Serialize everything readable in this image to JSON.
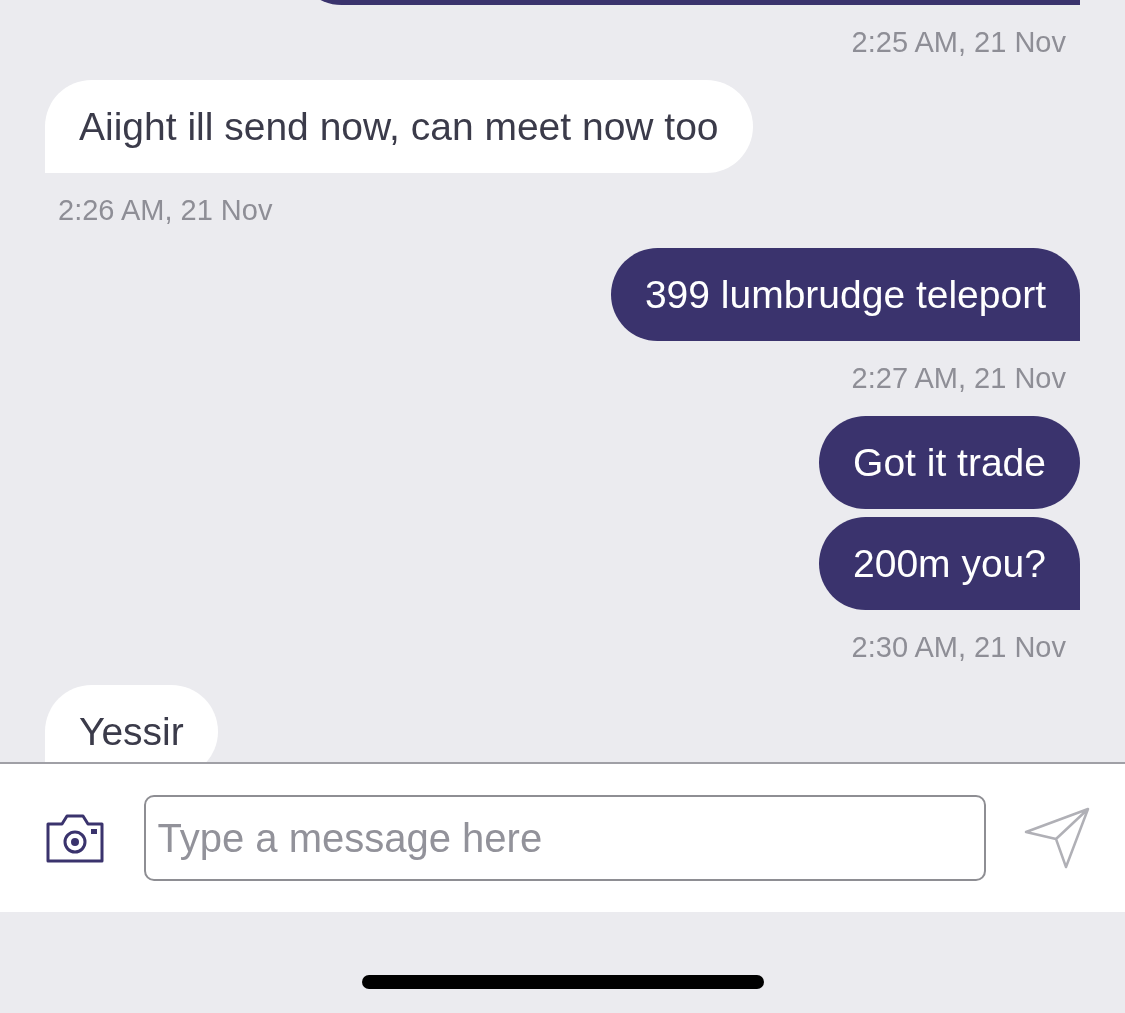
{
  "messages": [
    {
      "kind": "sent",
      "time": "2:25 AM, 21 Nov"
    },
    {
      "kind": "received",
      "text": "Aiight ill send now, can meet now too",
      "time": "2:26 AM, 21 Nov"
    },
    {
      "kind": "sent",
      "text": "399 lumbrudge teleport",
      "time": "2:27 AM, 21 Nov"
    },
    {
      "kind": "sent",
      "text": "Got it trade"
    },
    {
      "kind": "sent",
      "text": "200m you?",
      "time": "2:30 AM, 21 Nov"
    },
    {
      "kind": "received",
      "text": "Yessir"
    }
  ],
  "composer": {
    "placeholder": "Type a message here"
  }
}
